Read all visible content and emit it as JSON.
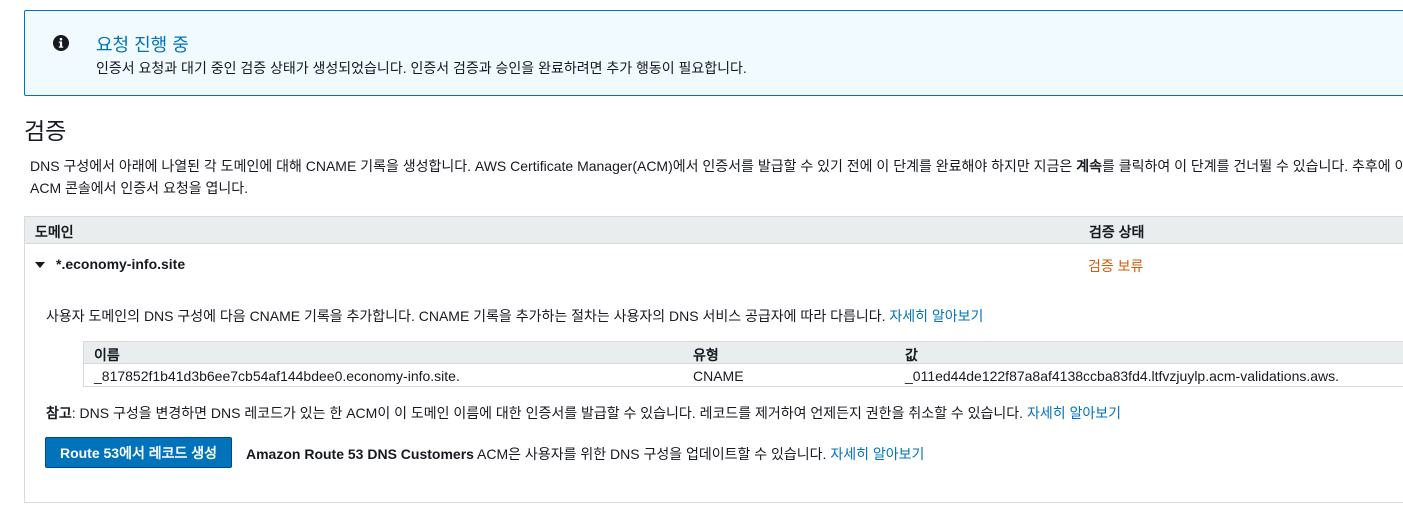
{
  "banner": {
    "icon": "info-icon",
    "title": "요청 진행 중",
    "message": "인증서 요청과 대기 중인 검증 상태가 생성되었습니다. 인증서 검증과 승인을 완료하려면 추가 행동이 필요합니다."
  },
  "section": {
    "title": "검증",
    "desc_part1": "DNS 구성에서 아래에 나열된 각 도메인에 대해 CNAME 기록을 생성합니다. AWS Certificate Manager(ACM)에서 인증서를 발급할 수 있기 전에 이 단계를 완료해야 하지만 지금은 ",
    "desc_bold": "계속",
    "desc_part2": "를 클릭하여 이 단계를 건너뛸 수 있습니다. 추후에 이",
    "desc_line2": "ACM 콘솔에서 인증서 요청을 엽니다."
  },
  "table": {
    "col_domain": "도메인",
    "col_status": "검증 상태",
    "domain": "*.economy-info.site",
    "status": "검증 보류",
    "status_color": "#d45b07"
  },
  "details": {
    "instruction": "사용자 도메인의 DNS 구성에 다음 CNAME 기록을 추가합니다. CNAME 기록을 추가하는 절차는 사용자의 DNS 서비스 공급자에 따라 다릅니다. ",
    "instruction_link": "자세히 알아보기",
    "record": {
      "h_name": "이름",
      "h_type": "유형",
      "h_value": "값",
      "name": "_817852f1b41d3b6ee7cb54af144bdee0.economy-info.site.",
      "type": "CNAME",
      "value": "_011ed44de122f87a8af4138ccba83fd4.ltfvzjuylp.acm-validations.aws."
    },
    "note_label": "참고",
    "note_text": ": DNS 구성을 변경하면 DNS 레코드가 있는 한 ACM이 이 도메인 이름에 대한 인증서를 발급할 수 있습니다. 레코드를 제거하여 언제든지 권한을 취소할 수 있습니다. ",
    "note_link": "자세히 알아보기",
    "route53_button": "Route 53에서 레코드 생성",
    "route53_bold": "Amazon Route 53 DNS Customers",
    "route53_text": " ACM은 사용자를 위한 DNS 구성을 업데이트할 수 있습니다. ",
    "route53_link": "자세히 알아보기"
  },
  "colors": {
    "accent": "#0073bb",
    "banner_bg": "#f1faff",
    "header_bg": "#eaeded"
  }
}
